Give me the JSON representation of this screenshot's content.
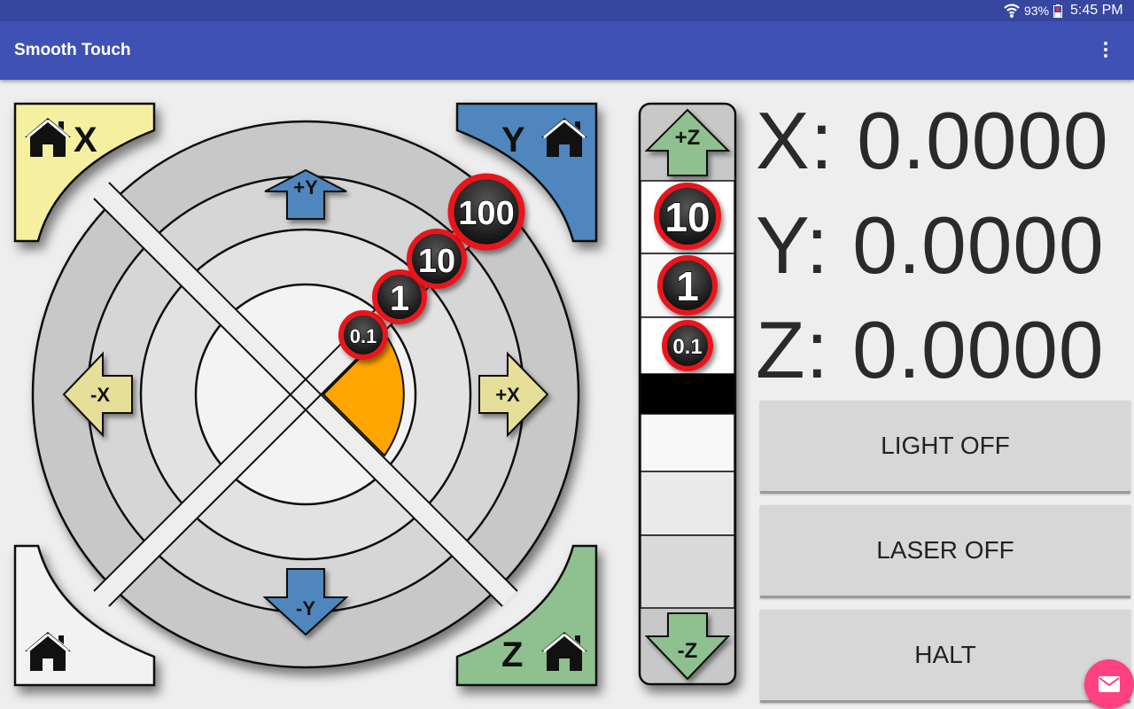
{
  "status_bar": {
    "battery": "93%",
    "time": "5:45 PM"
  },
  "app_bar": {
    "title": "Smooth Touch",
    "menu_icon": "more-vert-icon"
  },
  "jog": {
    "home_x_label": "X",
    "home_y_label": "Y",
    "home_z_label": "Z",
    "plus_y": "+Y",
    "minus_y": "-Y",
    "plus_x": "+X",
    "minus_x": "-X",
    "plus_z": "+Z",
    "minus_z": "-Z",
    "xy_steps": [
      "0.1",
      "1",
      "10",
      "100"
    ],
    "z_steps": [
      "10",
      "1",
      "0.1"
    ],
    "colors": {
      "home_x": "#f5efa0",
      "home_y": "#4f86bd",
      "home_z": "#8fc08f",
      "home_all": "#f2f2f2",
      "selected": "#ffa500"
    }
  },
  "position": {
    "x": "X: 0.0000",
    "y": "Y: 0.0000",
    "z": "Z: 0.0000"
  },
  "buttons": {
    "light": "LIGHT OFF",
    "laser": "LASER OFF",
    "halt": "HALT"
  },
  "fab_icon": "email-icon"
}
